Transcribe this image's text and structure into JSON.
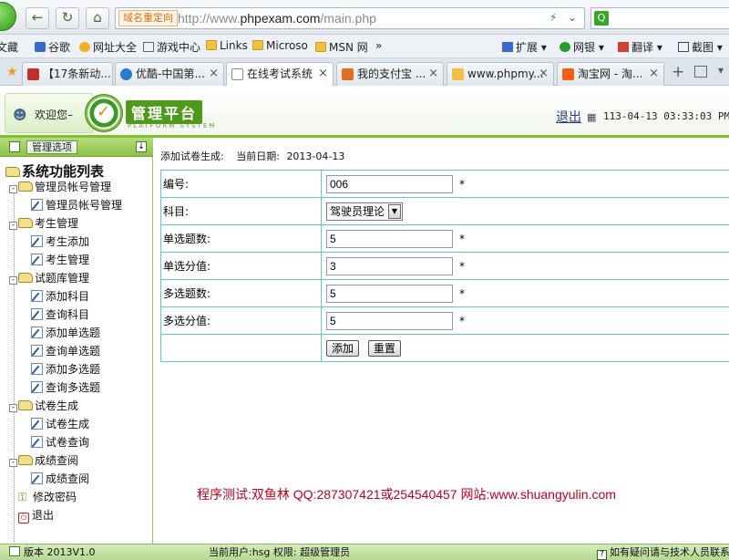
{
  "browser": {
    "url_tag": "域名重定向",
    "url_prefix": "http://www.",
    "url_domain": "phpexam.com",
    "url_path": "/main.php",
    "bookmarks": [
      "文藏",
      "谷歌",
      "网址大全",
      "游戏中心",
      "Links",
      "Microso",
      "MSN 网",
      "»"
    ],
    "toolbar_right": [
      "扩展",
      "网银",
      "翻译",
      "截图"
    ],
    "tabs": [
      {
        "label": "【17条新动..."
      },
      {
        "label": "优酷-中国第..."
      },
      {
        "label": "在线考试系统"
      },
      {
        "label": "我的支付宝 ..."
      },
      {
        "label": "www.phpmy..."
      },
      {
        "label": "淘宝网 - 淘..."
      }
    ]
  },
  "header": {
    "welcome": "欢迎您–",
    "platform_title": "管理平台",
    "platform_sub": "PLATFORM SYSTEM",
    "logout": "退出",
    "datetime": "113-04-13 03:33:03 PM"
  },
  "sidebar": {
    "header_label": "管理选项",
    "root": "系统功能列表",
    "groups": [
      {
        "label": "管理员帐号管理",
        "items": [
          "管理员帐号管理"
        ]
      },
      {
        "label": "考生管理",
        "items": [
          "考生添加",
          "考生管理"
        ]
      },
      {
        "label": "试题库管理",
        "items": [
          "添加科目",
          "查询科目",
          "添加单选题",
          "查询单选题",
          "添加多选题",
          "查询多选题"
        ]
      },
      {
        "label": "试卷生成",
        "items": [
          "试卷生成",
          "试卷查询"
        ]
      },
      {
        "label": "成绩查阅",
        "items": [
          "成绩查阅"
        ]
      }
    ],
    "change_password": "修改密码",
    "exit": "退出"
  },
  "main": {
    "page_title": "添加试卷生成:",
    "date_label": "当前日期:",
    "date_value": "2013-04-13",
    "form": {
      "rows": [
        {
          "label": "编号:",
          "value": "006",
          "required": "*"
        },
        {
          "label": "科目:",
          "value": "驾驶员理论"
        },
        {
          "label": "单选题数:",
          "value": "5",
          "required": "*"
        },
        {
          "label": "单选分值:",
          "value": "3",
          "required": "*"
        },
        {
          "label": "多选题数:",
          "value": "5",
          "required": "*"
        },
        {
          "label": "多选分值:",
          "value": "5",
          "required": "*"
        }
      ],
      "submit_label": "添加",
      "reset_label": "重置"
    },
    "credit": "程序测试:双鱼林 QQ:287307421或254540457 网站:www.shuangyulin.com"
  },
  "status": {
    "version": "版本 2013V1.0",
    "current_user": "当前用户:hsg 权限: 超级管理员",
    "help": "如有疑问请与技术人员联系"
  }
}
